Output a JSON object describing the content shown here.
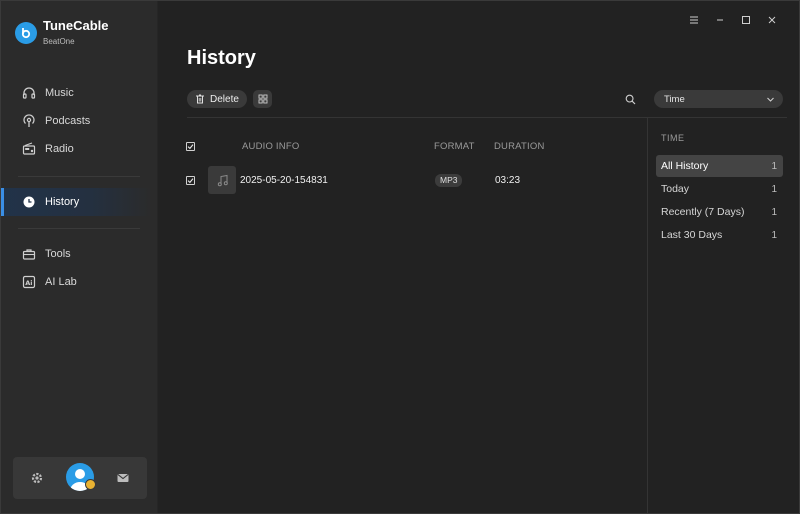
{
  "app": {
    "name": "TuneCable",
    "subtitle": "BeatOne"
  },
  "sidebar": {
    "items": [
      {
        "label": "Music",
        "icon": "headphones-icon"
      },
      {
        "label": "Podcasts",
        "icon": "podcast-icon"
      },
      {
        "label": "Radio",
        "icon": "radio-icon"
      },
      {
        "label": "History",
        "icon": "clock-icon",
        "active": true
      },
      {
        "label": "Tools",
        "icon": "toolbox-icon"
      },
      {
        "label": "AI Lab",
        "icon": "ai-icon"
      }
    ]
  },
  "page": {
    "title": "History"
  },
  "toolbar": {
    "delete_label": "Delete",
    "sort_value": "Time"
  },
  "table": {
    "columns": [
      "AUDIO INFO",
      "FORMAT",
      "DURATION"
    ],
    "rows": [
      {
        "name": "2025-05-20-154831",
        "format": "MP3",
        "duration": "03:23",
        "checked": true
      }
    ]
  },
  "filter": {
    "heading": "TIME",
    "items": [
      {
        "label": "All History",
        "count": "1",
        "active": true
      },
      {
        "label": "Today",
        "count": "1"
      },
      {
        "label": "Recently (7 Days)",
        "count": "1"
      },
      {
        "label": "Last 30 Days",
        "count": "1"
      }
    ]
  },
  "colors": {
    "accent": "#2a9ce6",
    "sidebar_bg": "#2b2b2b",
    "main_bg": "#222222",
    "badge": "#e9b232"
  }
}
